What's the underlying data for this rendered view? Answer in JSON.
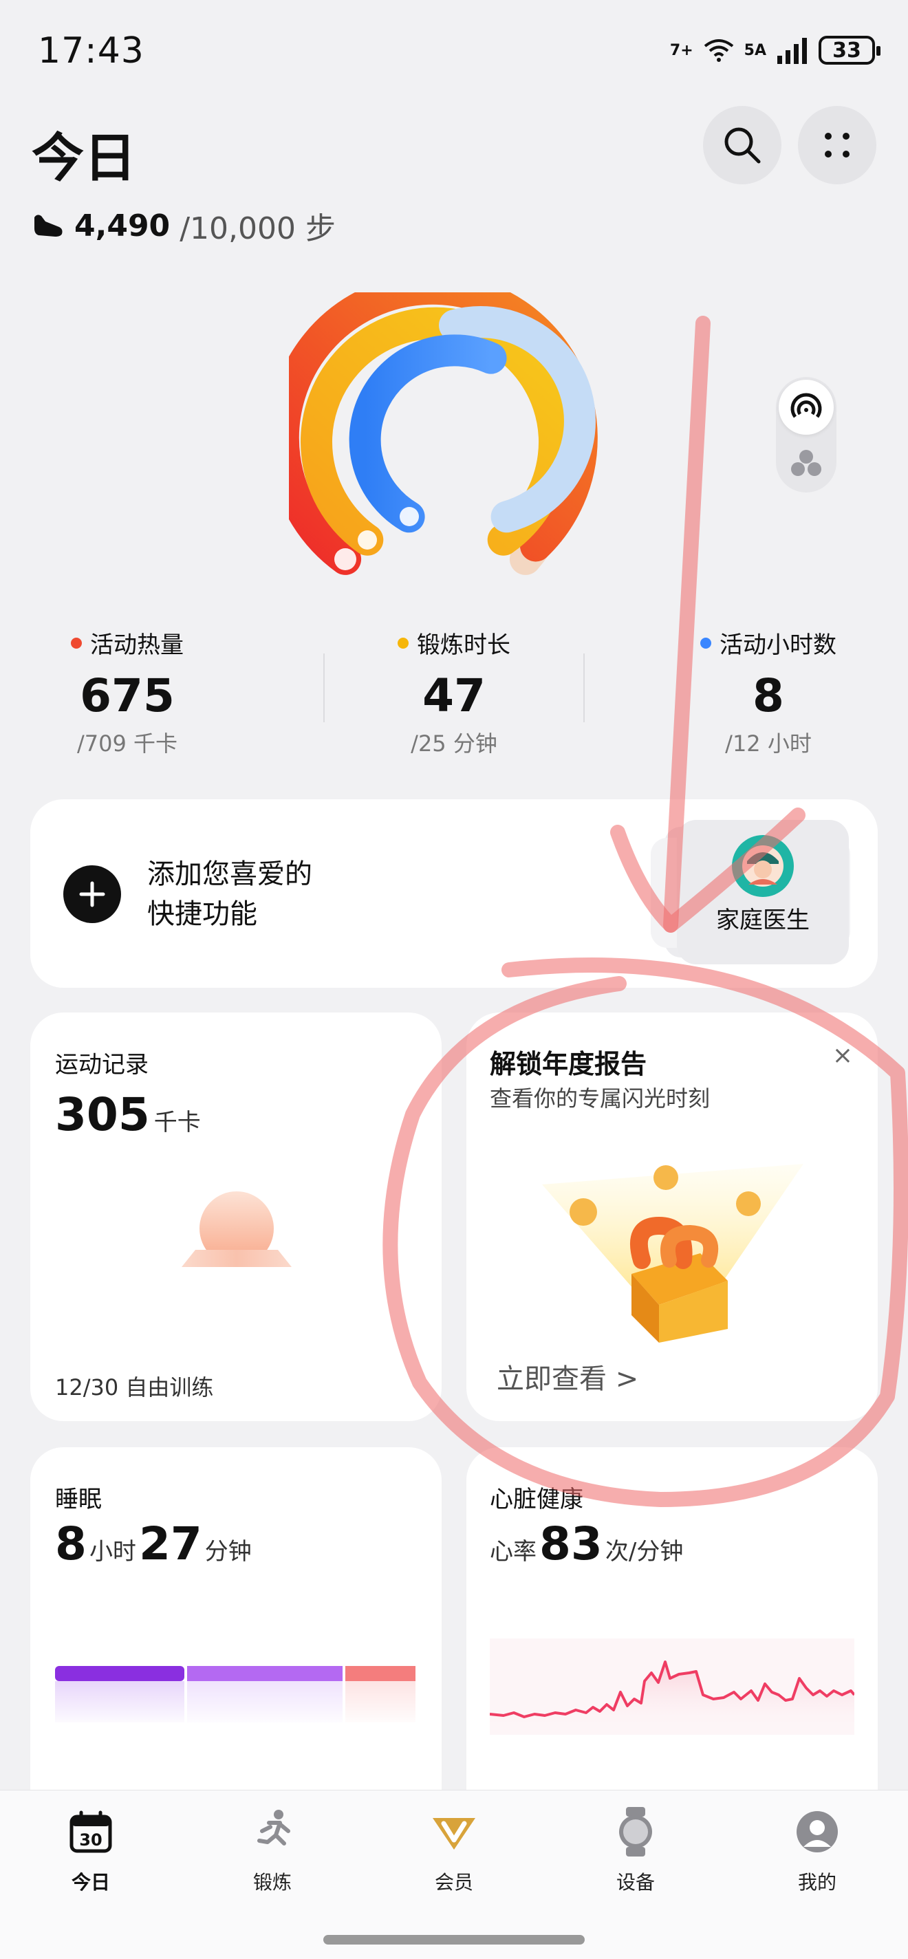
{
  "status_bar": {
    "time": "17:43",
    "wifi_label": "7+",
    "signal_label": "5A",
    "battery": "33"
  },
  "header": {
    "title": "今日",
    "search_icon": "search-icon",
    "more_icon": "more-dots-icon"
  },
  "steps": {
    "value": "4,490",
    "goal": "/10,000 步"
  },
  "rings": {
    "calories_fraction": 0.95,
    "exercise_fraction": 1.0,
    "active_hours_fraction": 0.67
  },
  "metrics": [
    {
      "label": "活动热量",
      "value": "675",
      "goal": "/709 千卡",
      "color": "#ef4a30"
    },
    {
      "label": "锻炼时长",
      "value": "47",
      "goal": "/25 分钟",
      "color": "#f6b60a"
    },
    {
      "label": "活动小时数",
      "value": "8",
      "goal": "/12 小时",
      "color": "#3a86ff"
    }
  ],
  "quick_access": {
    "text": "添加您喜爱的快捷功能",
    "line1": "添加您喜爱的",
    "line2": "快捷功能",
    "doctor_label": "家庭医生"
  },
  "exercise": {
    "title": "运动记录",
    "value": "305",
    "unit": "千卡",
    "date": "12/30 自由训练"
  },
  "annual_report": {
    "title": "解锁年度报告",
    "subtitle": "查看你的专属闪光时刻",
    "link": "立即查看 >",
    "close": "×"
  },
  "sleep": {
    "title": "睡眠",
    "hours": "8",
    "hours_unit": "小时",
    "minutes": "27",
    "minutes_unit": "分钟"
  },
  "heart": {
    "title": "心脏健康",
    "prefix": "心率",
    "value": "83",
    "unit": "次/分钟"
  },
  "nav": [
    {
      "label": "今日",
      "icon": "calendar-icon",
      "badge": "30"
    },
    {
      "label": "锻炼",
      "icon": "running-icon"
    },
    {
      "label": "会员",
      "icon": "vip-icon"
    },
    {
      "label": "设备",
      "icon": "watch-icon"
    },
    {
      "label": "我的",
      "icon": "profile-icon"
    }
  ]
}
